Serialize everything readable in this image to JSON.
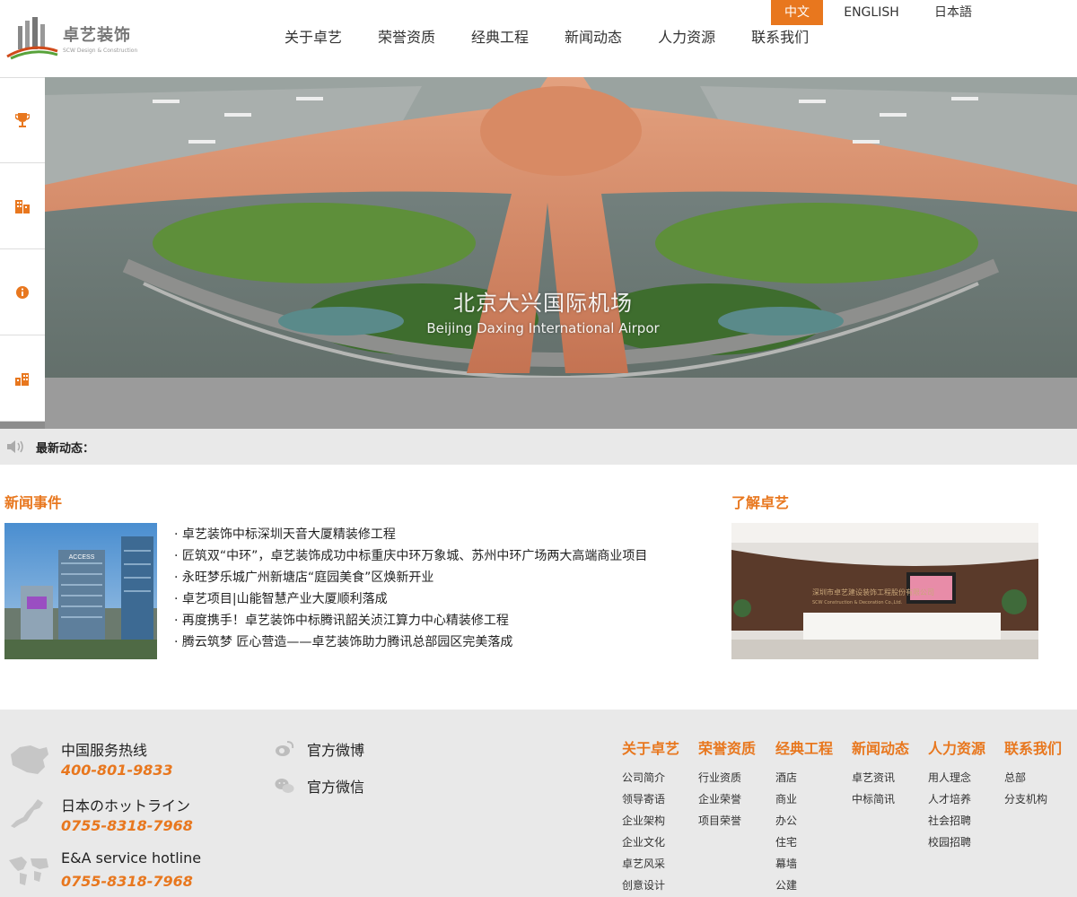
{
  "brand": {
    "name_cn": "卓艺装饰",
    "name_en": "SCW Design & Construction"
  },
  "languages": [
    {
      "label": "中文",
      "active": true
    },
    {
      "label": "ENGLISH",
      "active": false
    },
    {
      "label": "日本語",
      "active": false
    }
  ],
  "nav": [
    "关于卓艺",
    "荣誉资质",
    "经典工程",
    "新闻动态",
    "人力资源",
    "联系我们"
  ],
  "banner": {
    "caption_cn": "北京大兴国际机场",
    "caption_en": "Beijing Daxing International Airpor"
  },
  "side_icons": [
    "trophy-icon",
    "building-icon",
    "info-icon",
    "chart-building-icon"
  ],
  "notice": {
    "label": "最新动态："
  },
  "news": {
    "title": "新闻事件",
    "image_sign": "ACCESS",
    "items": [
      "· 卓艺装饰中标深圳天音大厦精装修工程",
      "· 匠筑双“中环”，卓艺装饰成功中标重庆中环万象城、苏州中环广场两大高端商业项目",
      "· 永旺梦乐城广州新塘店“庭园美食”区焕新开业",
      "· 卓艺项目|山能智慧产业大厦顺利落成",
      "· 再度携手！卓艺装饰中标腾讯韶关浈江算力中心精装修工程",
      "· 腾云筑梦 匠心营造——卓艺装饰助力腾讯总部园区完美落成"
    ]
  },
  "about": {
    "title": "了解卓艺",
    "wall_text_cn": "深圳市卓艺建设装饰工程股份有限公司",
    "wall_text_en": "SCW Construction & Decoration Co.,Ltd."
  },
  "footer": {
    "hotlines": [
      {
        "title": "中国服务热线",
        "number": "400-801-9833",
        "icon": "china-map-icon"
      },
      {
        "title": "日本のホットライン",
        "number": "0755-8318-7968",
        "icon": "japan-map-icon"
      },
      {
        "title": "E&A service hotline",
        "number": "0755-8318-7968",
        "icon": "world-map-icon"
      }
    ],
    "social": [
      {
        "label": "官方微博",
        "icon": "weibo-icon"
      },
      {
        "label": "官方微信",
        "icon": "wechat-icon"
      }
    ],
    "columns": [
      {
        "title": "关于卓艺",
        "links": [
          "公司简介",
          "领导寄语",
          "企业架构",
          "企业文化",
          "卓艺风采",
          "创意设计"
        ]
      },
      {
        "title": "荣誉资质",
        "links": [
          "行业资质",
          "企业荣誉",
          "项目荣誉"
        ]
      },
      {
        "title": "经典工程",
        "links": [
          "酒店",
          "商业",
          "办公",
          "住宅",
          "幕墙",
          "公建"
        ]
      },
      {
        "title": "新闻动态",
        "links": [
          "卓艺资讯",
          "中标简讯"
        ]
      },
      {
        "title": "人力资源",
        "links": [
          "用人理念",
          "人才培养",
          "社会招聘",
          "校园招聘"
        ]
      },
      {
        "title": "联系我们",
        "links": [
          "总部",
          "分支机构"
        ]
      }
    ]
  },
  "colors": {
    "accent": "#e8771e",
    "gray_bg": "#e9e9e9"
  }
}
